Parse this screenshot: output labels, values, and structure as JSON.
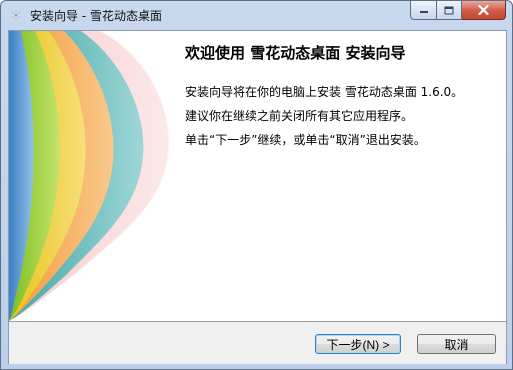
{
  "window": {
    "title": "安装向导 - 雪花动态桌面",
    "controls": {
      "minimize_icon": "minimize-icon",
      "maximize_icon": "maximize-icon",
      "close_icon": "close-icon"
    }
  },
  "welcome": {
    "heading": "欢迎使用 雪花动态桌面 安装向导",
    "line1": "安装向导将在你的电脑上安装 雪花动态桌面 1.6.0。",
    "line2": "建议你在继续之前关闭所有其它应用程序。",
    "line3": "单击“下一步”继续，或单击“取消”退出安装。"
  },
  "buttons": {
    "next": "下一步(N) >",
    "cancel": "取消"
  },
  "colors": {
    "titlebar": "#c8d9ee",
    "close_button": "#cf5a45",
    "footer": "#f0f0f0"
  }
}
